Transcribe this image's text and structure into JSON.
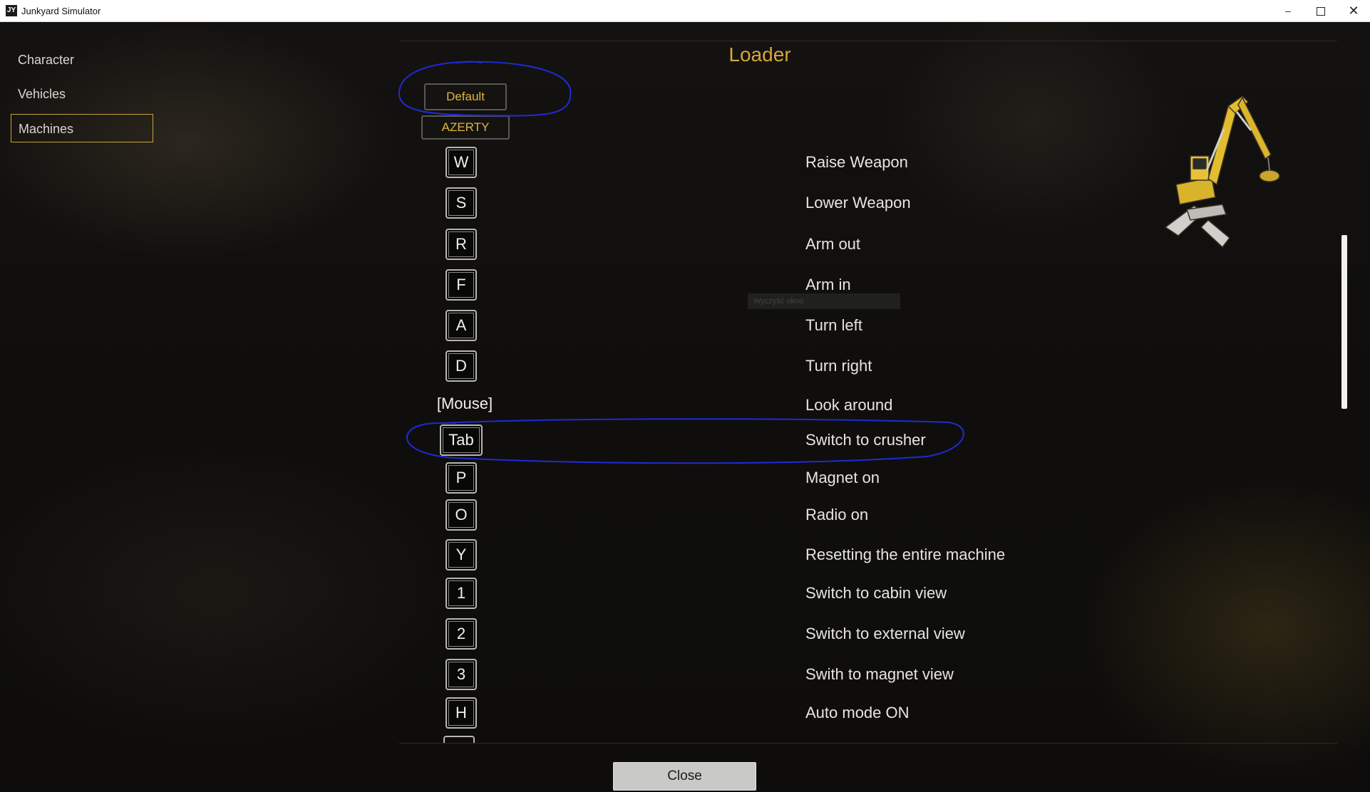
{
  "window": {
    "icon_text": "JY",
    "title": "Junkyard Simulator",
    "minimize": "–",
    "close": "✕"
  },
  "sidebar": {
    "items": [
      {
        "label": "Character",
        "active": false
      },
      {
        "label": "Vehicles",
        "active": false
      },
      {
        "label": "Machines",
        "active": true
      }
    ]
  },
  "main": {
    "title": "Loader",
    "layouts": {
      "default": "Default",
      "azerty": "AZERTY"
    },
    "bindings": [
      {
        "key": "W",
        "action": "Raise Weapon"
      },
      {
        "key": "S",
        "action": "Lower Weapon"
      },
      {
        "key": "R",
        "action": "Arm out"
      },
      {
        "key": "F",
        "action": "Arm in"
      },
      {
        "key": "A",
        "action": "Turn left"
      },
      {
        "key": "D",
        "action": "Turn right"
      },
      {
        "key": "[Mouse]",
        "action": "Look around"
      },
      {
        "key": "Tab",
        "action": "Switch to crusher"
      },
      {
        "key": "P",
        "action": "Magnet on"
      },
      {
        "key": "O",
        "action": "Radio on"
      },
      {
        "key": "Y",
        "action": "Resetting the entire machine"
      },
      {
        "key": "1",
        "action": "Switch to cabin view"
      },
      {
        "key": "2",
        "action": "Switch to external view"
      },
      {
        "key": "3",
        "action": "Swith to magnet view"
      },
      {
        "key": "H",
        "action": "Auto mode ON"
      }
    ],
    "tooltip": "Wyczyść okno",
    "close_button": "Close"
  },
  "colors": {
    "accent": "#d7a63c",
    "annotation": "#1f2bd6",
    "text": "#e8e5de"
  }
}
